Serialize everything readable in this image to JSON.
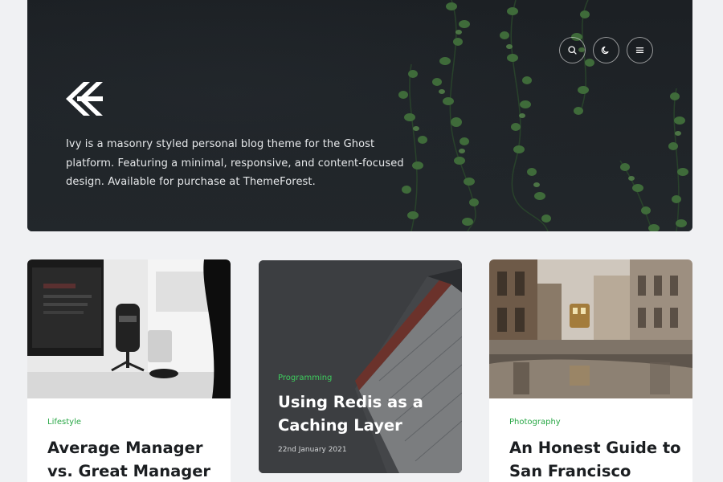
{
  "header": {
    "intro": "Ivy is a masonry styled personal blog theme for the Ghost platform. Featuring a minimal, responsive, and content-focused design. Available for purchase at ThemeForest.",
    "icons": [
      "search-icon",
      "moon-icon",
      "menu-icon"
    ]
  },
  "colors": {
    "accent": "#28a745",
    "background": "#f0f1f3",
    "hero": "#1e2226"
  },
  "posts": [
    {
      "tag": "Lifestyle",
      "title": "Average Manager vs. Great Manager"
    },
    {
      "tag": "Programming",
      "title": "Using Redis as a Caching Layer",
      "date": "22nd January 2021"
    },
    {
      "tag": "Photography",
      "title": "An Honest Guide to San Francisco"
    }
  ]
}
